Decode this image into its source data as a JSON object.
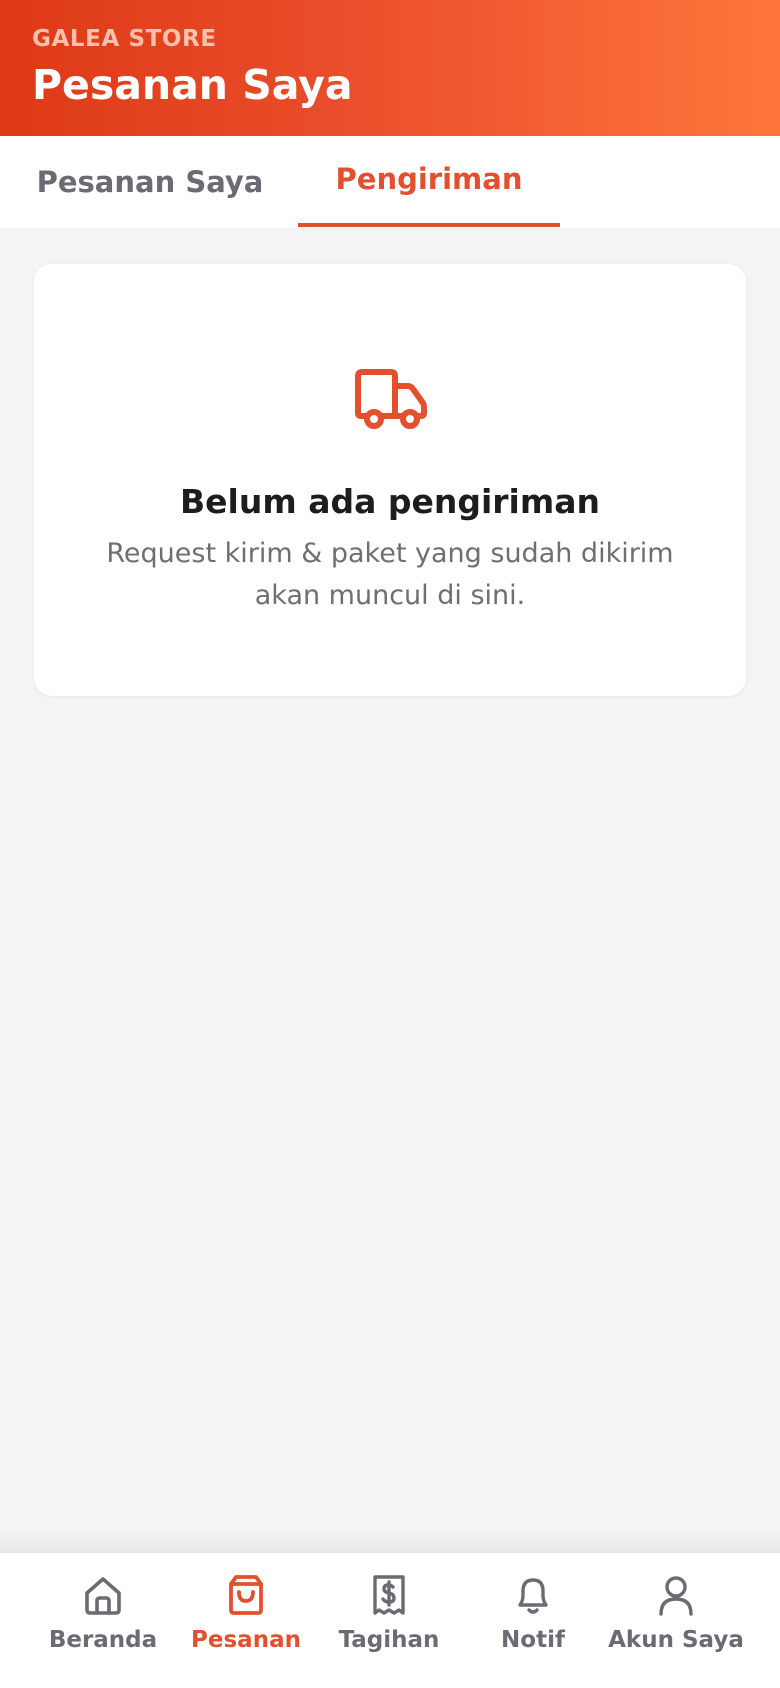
{
  "header": {
    "store_name": "GALEA STORE",
    "title": "Pesanan Saya"
  },
  "tabs": [
    {
      "label": "Pesanan Saya",
      "active": false
    },
    {
      "label": "Pengiriman",
      "active": true
    }
  ],
  "empty_state": {
    "icon": "truck-icon",
    "title": "Belum ada pengiriman",
    "description": "Request kirim & paket yang sudah dikirim akan muncul di sini."
  },
  "bottom_nav": [
    {
      "label": "Beranda",
      "icon": "home-icon",
      "active": false
    },
    {
      "label": "Pesanan",
      "icon": "shopping-bag-icon",
      "active": true
    },
    {
      "label": "Tagihan",
      "icon": "receipt-icon",
      "active": false
    },
    {
      "label": "Notif",
      "icon": "bell-icon",
      "active": false
    },
    {
      "label": "Akun Saya",
      "icon": "user-icon",
      "active": false
    }
  ],
  "colors": {
    "accent": "#e2502d",
    "header_gradient_start": "#de3916",
    "header_gradient_end": "#ff763b",
    "muted_text": "#6b6b73",
    "background": "#f4f4f5"
  }
}
